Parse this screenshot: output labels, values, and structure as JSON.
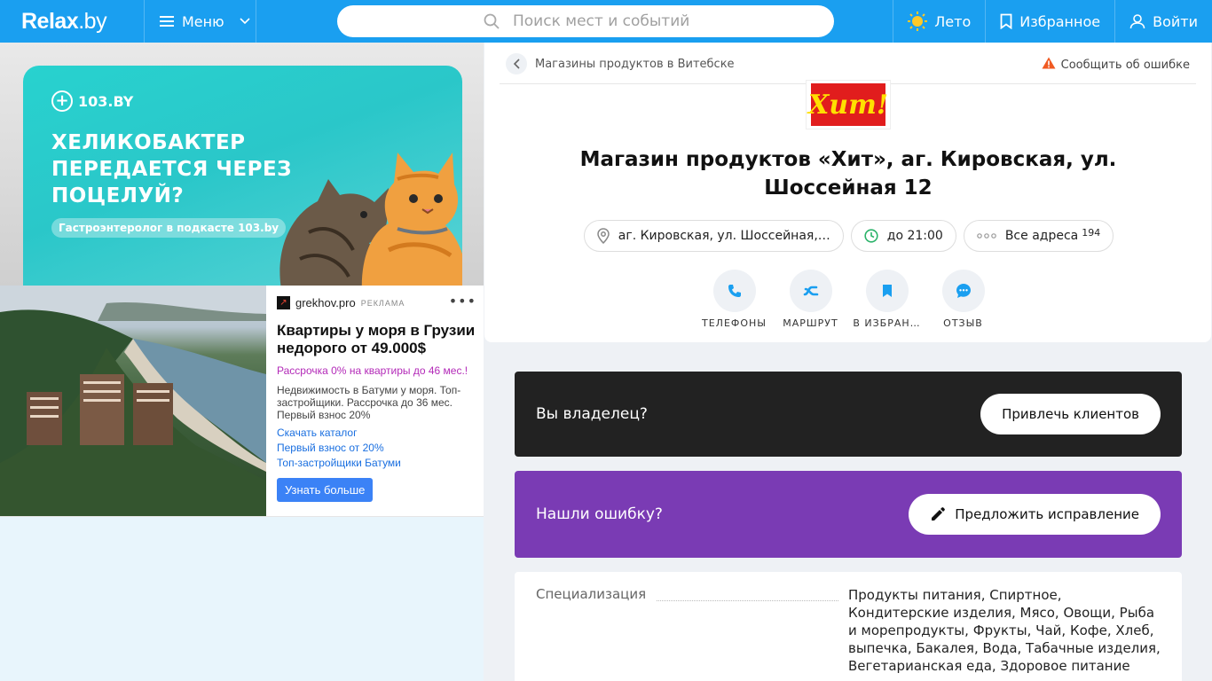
{
  "header": {
    "logo": "Relax",
    "logo_suffix": ".by",
    "menu_label": "Меню",
    "search_placeholder": "Поиск мест и событий",
    "season_label": "Лето",
    "favorites_label": "Избранное",
    "login_label": "Войти"
  },
  "colors": {
    "header_bg": "#1a9ff0",
    "owner_bg": "#222222",
    "fix_bg": "#7a3bb4",
    "hit_logo_red": "#e11d1d",
    "hit_logo_yellow": "#ffe000"
  },
  "ads": {
    "ad1": {
      "brand": "103.BY",
      "headline_lines": [
        "ХЕЛИКОБАКТЕР",
        "ПЕРЕДАЕТСЯ ЧЕРЕЗ",
        "ПОЦЕЛУЙ?"
      ],
      "pill": "Гастроэнтеролог в подкасте 103.by"
    },
    "ad2": {
      "source": "grekhov.pro",
      "tag": "РЕКЛАМА",
      "title": "Квартиры у моря в Грузии недорого от 49.000$",
      "promo": "Рассрочка 0% на квартиры до 46 мес.!",
      "desc": "Недвижимость в Батуми у моря. Топ-застройщики. Рассрочка до 36 мес. Первый взнос 20%",
      "links": [
        "Скачать каталог",
        "Первый взнос от 20%",
        "Топ-застройщики Батуми"
      ],
      "button": "Узнать больше"
    }
  },
  "place": {
    "breadcrumb": "Магазины продуктов в Витебске",
    "report": "Сообщить об ошибке",
    "logo_text": "Хит!",
    "title": "Магазин продуктов «Хит», аг. Кировская, ул. Шоссейная 12",
    "address": "аг. Кировская, ул. Шоссейная,…",
    "hours": "до 21:00",
    "all_addresses": "Все адреса",
    "addresses_count": "194",
    "actions": [
      "ТЕЛЕФОНЫ",
      "МАРШРУТ",
      "В ИЗБРАН…",
      "ОТЗЫВ"
    ]
  },
  "owner": {
    "question": "Вы владелец?",
    "button": "Привлечь клиентов"
  },
  "fix": {
    "question": "Нашли ошибку?",
    "button": "Предложить исправление"
  },
  "specialization": {
    "label": "Специализация",
    "value": "Продукты питания, Спиртное, Кондитерские изделия, Мясо, Овощи, Рыба и морепродукты, Фрукты, Чай, Кофе, Хлеб, выпечка, Бакалея, Вода, Табачные изделия, Вегетарианская еда, Здоровое питание"
  }
}
